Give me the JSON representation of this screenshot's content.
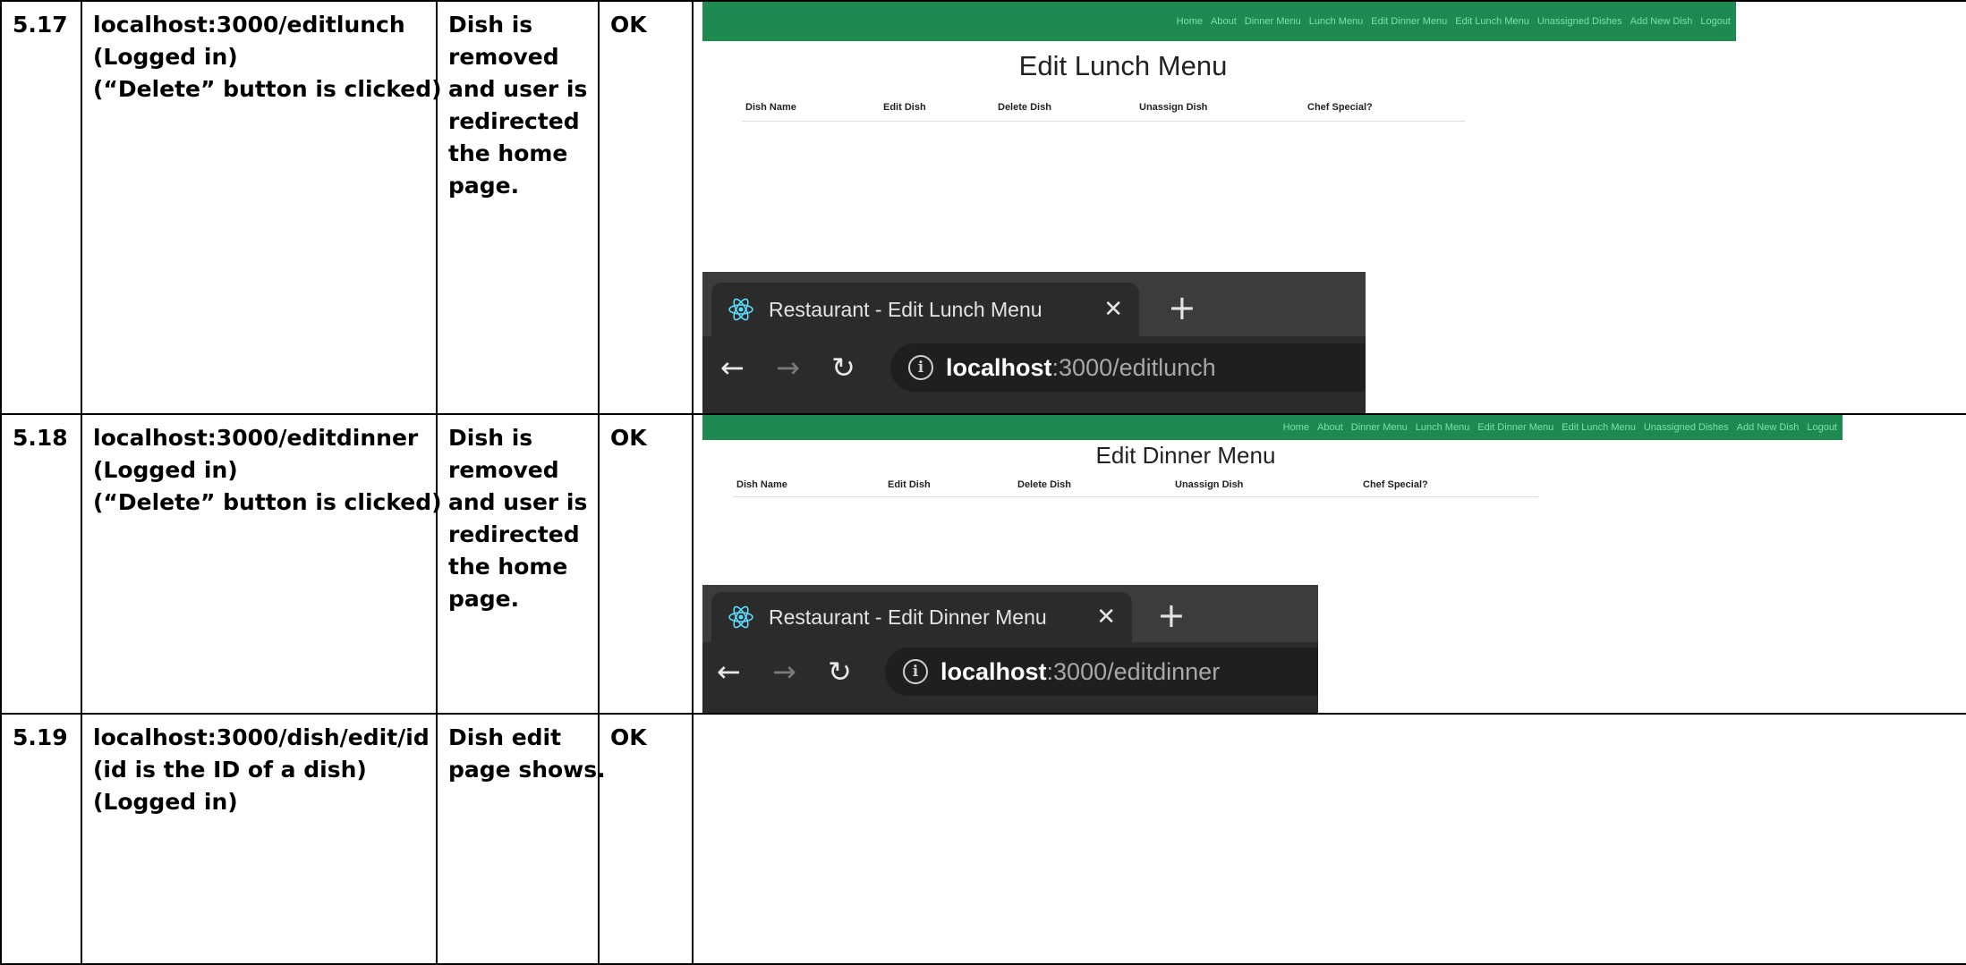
{
  "rows": [
    {
      "id": "5.17",
      "url_lines": [
        "localhost:3000/editlunch",
        "(Logged in)",
        "(“Delete” button is clicked)"
      ],
      "expected_lines": [
        "Dish is",
        "removed",
        "and user is",
        "redirected",
        "the home",
        "page."
      ],
      "result": "OK",
      "screenshot": {
        "nav_links": [
          "Home",
          "About",
          "Dinner Menu",
          "Lunch Menu",
          "Edit Dinner Menu",
          "Edit Lunch Menu",
          "Unassigned Dishes",
          "Add New Dish",
          "Logout"
        ],
        "page_title": "Edit Lunch Menu",
        "columns": [
          "Dish Name",
          "Edit Dish",
          "Delete Dish",
          "Unassign Dish",
          "Chef Special?"
        ],
        "tab_title": "Restaurant - Edit Lunch Menu",
        "url_host": "localhost",
        "url_path": ":3000/editlunch"
      }
    },
    {
      "id": "5.18",
      "url_lines": [
        "localhost:3000/editdinner",
        "(Logged in)",
        "(“Delete” button is clicked)"
      ],
      "expected_lines": [
        "Dish is",
        "removed",
        "and user is",
        "redirected",
        "the home",
        "page."
      ],
      "result": "OK",
      "screenshot": {
        "nav_links": [
          "Home",
          "About",
          "Dinner Menu",
          "Lunch Menu",
          "Edit Dinner Menu",
          "Edit Lunch Menu",
          "Unassigned Dishes",
          "Add New Dish",
          "Logout"
        ],
        "page_title": "Edit Dinner Menu",
        "columns": [
          "Dish Name",
          "Edit Dish",
          "Delete Dish",
          "Unassign Dish",
          "Chef Special?"
        ],
        "tab_title": "Restaurant - Edit Dinner Menu",
        "url_host": "localhost",
        "url_path": ":3000/editdinner"
      }
    },
    {
      "id": "5.19",
      "url_lines": [
        "localhost:3000/dish/edit/id",
        "(id is the ID of a dish)",
        "(Logged in)"
      ],
      "expected_lines": [
        "Dish edit",
        "page shows."
      ],
      "result": "OK"
    }
  ],
  "glyphs": {
    "close": "✕",
    "new_tab": "+",
    "back": "←",
    "forward": "→",
    "reload": "↻",
    "info": "i"
  },
  "colors": {
    "navbar_green": "#1e8a52",
    "nav_link": "#7fe0aa",
    "browser_dark": "#3c3c3c",
    "browser_toolbar": "#2b2b2b"
  }
}
